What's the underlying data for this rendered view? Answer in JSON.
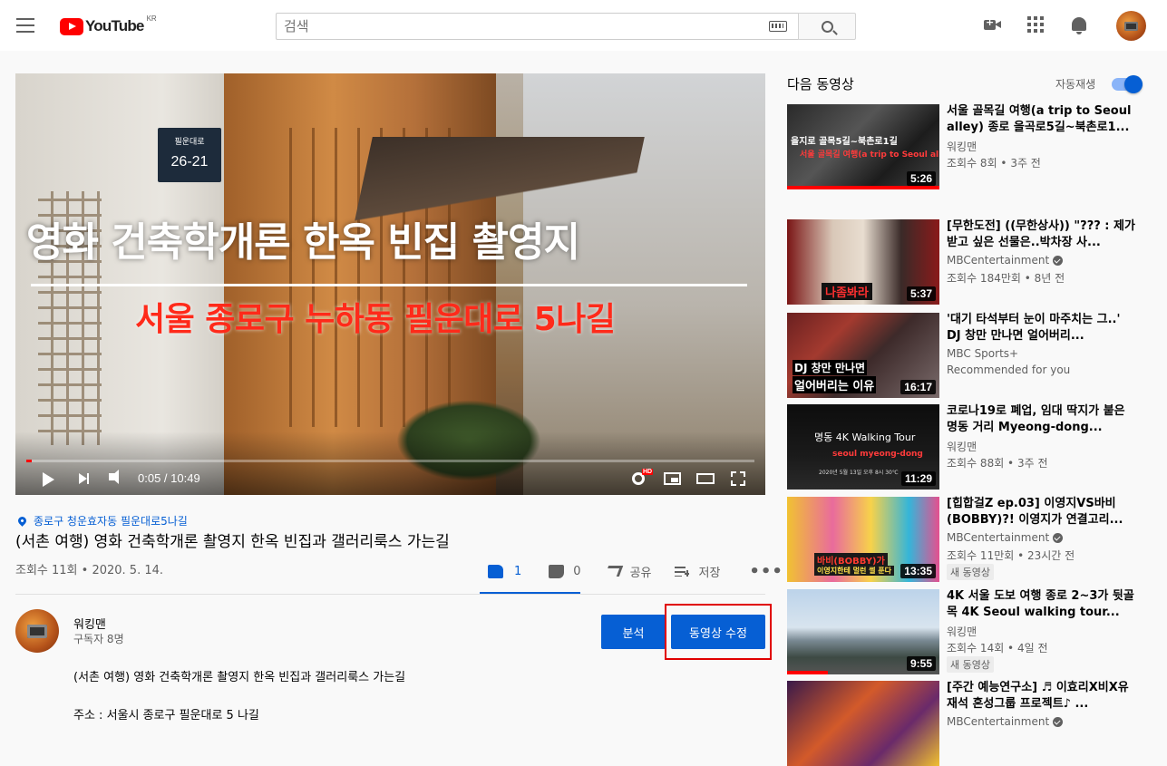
{
  "header": {
    "logo_text": "YouTube",
    "logo_region": "KR",
    "search_placeholder": "검색"
  },
  "player": {
    "plaque_street": "필운대로",
    "plaque_number": "26-21",
    "overlay_title": "영화 건축학개론 한옥 빈집 촬영지",
    "overlay_subtitle": "서울 종로구 누하동 필운대로 5나길",
    "time": "0:05 / 10:49",
    "hd_badge": "HD",
    "progress_fraction": 0.008
  },
  "video": {
    "location": "종로구 청운효자동 필운대로5나길",
    "title": "(서촌 여행) 영화 건축학개론 촬영지 한옥 빈집과 갤러리룩스 가는길",
    "views_date": "조회수 11회 • 2020. 5. 14.",
    "like_count": "1",
    "dislike_count": "0",
    "share_label": "공유",
    "save_label": "저장",
    "more_label": "•••"
  },
  "channel": {
    "name": "워킹맨",
    "subscribers": "구독자 8명",
    "analytics_label": "분석",
    "edit_label": "동영상 수정"
  },
  "description": {
    "line1": "(서촌 여행) 영화 건축학개론 촬영지 한옥 빈집과 갤러리룩스 가는길",
    "line2": "주소 : 서울시 종로구 필운대로 5 나길"
  },
  "sidebar": {
    "up_next": "다음 동영상",
    "autoplay_label": "자동재생",
    "autoplay_on": true,
    "items": [
      {
        "title": "서울 골목길 여행(a trip to Seoul alley) 종로 을곡로5길~북촌로1...",
        "channel": "워킹맨",
        "verified": false,
        "meta": "조회수 8회 • 3주 전",
        "duration": "5:26",
        "watched_fraction": 1.0,
        "thumb_text": [
          "을지로 골목5길~북촌로1길",
          "서울 골목길 여행(a trip to Seoul alley)"
        ],
        "badge": ""
      },
      {
        "title": "[무한도전] ((무한상사)) \"??? : 제가 받고 싶은 선물은..박차장 사...",
        "channel": "MBCentertainment",
        "verified": true,
        "meta": "조회수 184만회 • 8년 전",
        "duration": "5:37",
        "watched_fraction": 0,
        "thumb_text": [
          "나좀봐라"
        ],
        "badge": ""
      },
      {
        "title": "'대기 타석부터 눈이 마주치는 그..' DJ 창만 만나면 얼어버리...",
        "channel": "MBC Sports+",
        "verified": false,
        "meta": "Recommended for you",
        "duration": "16:17",
        "watched_fraction": 0,
        "thumb_text": [
          "DJ 창만 만나면",
          "얼어버리는 이유"
        ],
        "badge": ""
      },
      {
        "title": "코로나19로 폐업, 임대 딱지가 붙은 명동 거리 Myeong-dong...",
        "channel": "워킹맨",
        "verified": false,
        "meta": "조회수 88회 • 3주 전",
        "duration": "11:29",
        "watched_fraction": 0,
        "thumb_text": [
          "명동 4K Walking Tour",
          "seoul myeong-dong",
          "2020년 5월 13일 오후 8시 30℃"
        ],
        "badge": ""
      },
      {
        "title": "[힙합걸Z ep.03] 이영지VS바비(BOBBY)?! 이영지가 연결고리...",
        "channel": "MBCentertainment",
        "verified": true,
        "meta": "조회수 11만회 • 23시간 전",
        "duration": "13:35",
        "watched_fraction": 0,
        "thumb_text": [
          "바비(BOBBY)가",
          "이영지한테 멀런 썰 푼다"
        ],
        "badge": "새 동영상"
      },
      {
        "title": "4K 서울 도보 여행 종로 2~3가 뒷골목 4K Seoul walking tour...",
        "channel": "워킹맨",
        "verified": false,
        "meta": "조회수 14회 • 4일 전",
        "duration": "9:55",
        "watched_fraction": 0.27,
        "thumb_text": [],
        "badge": "새 동영상"
      },
      {
        "title": "[주간 예능연구소] ♬ 이효리X비X유재석 혼성그룹 프로젝트♪ ...",
        "channel": "MBCentertainment",
        "verified": true,
        "meta": "",
        "duration": "",
        "watched_fraction": 0,
        "thumb_text": [],
        "badge": ""
      }
    ]
  },
  "colors": {
    "accent_blue": "#065fd4",
    "brand_red": "#ff0000",
    "highlight_red": "#e00000"
  }
}
